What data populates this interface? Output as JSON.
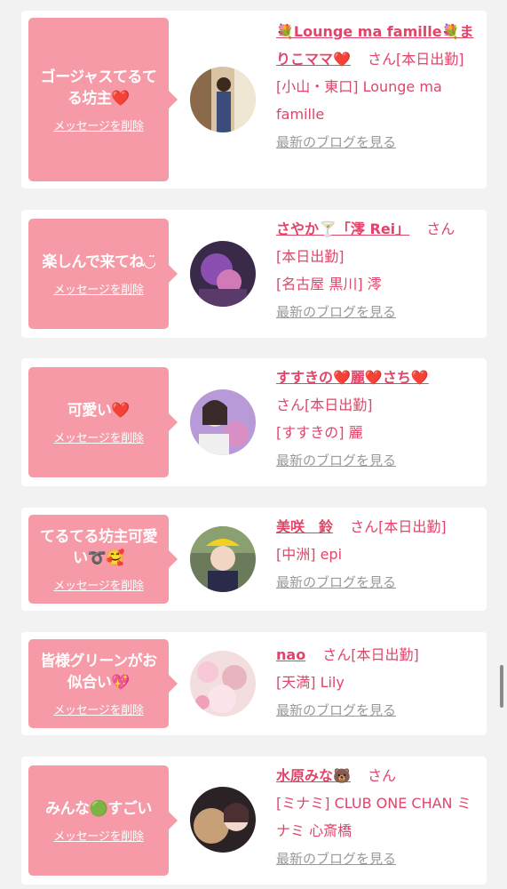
{
  "delete_label": "メッセージを削除",
  "blog_label": "最新のブログを見る",
  "cards": [
    {
      "message": "ゴージャスてるてる坊主❤️",
      "name": "💐Lounge ma famille💐まりこママ❤️",
      "san": "さん",
      "status": "[本日出勤]",
      "shop": "[小山・東口] Lounge ma famille",
      "avatar": "woman-in-kimono-photo"
    },
    {
      "message": "楽しんで来てね◡̈",
      "name": "さやか🍸「澪 Rei」",
      "san": "さん",
      "status": "[本日出勤]",
      "shop": "[名古屋 黒川] 澪",
      "avatar": "costume-purple-photo"
    },
    {
      "message": "可愛い❤️",
      "name": "すすきの❤️麗❤️さち❤️",
      "san": "さん",
      "status": "[本日出勤]",
      "shop": "[すすきの] 麗",
      "avatar": "woman-balloon-photo"
    },
    {
      "message": "てるてる坊主可愛い➰🥰",
      "name": "美咲　鈴",
      "san": "さん",
      "status": "[本日出勤]",
      "shop": "[中洲] epi",
      "avatar": "woman-yellow-cap-photo"
    },
    {
      "message": "皆様グリーンがお似合い💖",
      "name": "nao",
      "san": "さん",
      "status": "[本日出勤]",
      "shop": "[天満] Lily",
      "avatar": "woman-pink-photo"
    },
    {
      "message": "みんな🟢すごい",
      "name": "水原みな🐻",
      "san": "さん",
      "status": "",
      "shop": "[ミナミ] CLUB ONE CHAN ミナミ 心斎橋",
      "avatar": "woman-bear-plush-photo"
    }
  ],
  "colors": {
    "accent": "#e0456a",
    "bubble": "#f79aa7",
    "background": "#f2f2f2",
    "muted": "#999999"
  }
}
